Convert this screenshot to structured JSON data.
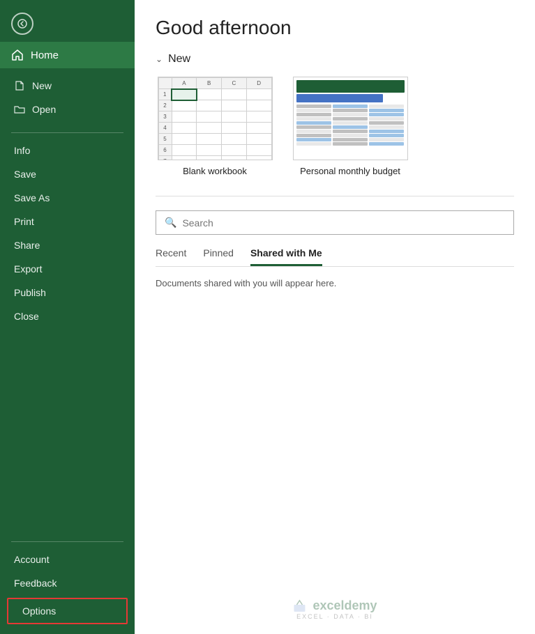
{
  "sidebar": {
    "back_label": "Back",
    "home_label": "Home",
    "nav_items": [
      {
        "id": "new",
        "label": "New",
        "icon": "file-new-icon"
      },
      {
        "id": "open",
        "label": "Open",
        "icon": "folder-icon"
      }
    ],
    "menu_items": [
      {
        "id": "info",
        "label": "Info"
      },
      {
        "id": "save",
        "label": "Save"
      },
      {
        "id": "save-as",
        "label": "Save As"
      },
      {
        "id": "print",
        "label": "Print"
      },
      {
        "id": "share",
        "label": "Share"
      },
      {
        "id": "export",
        "label": "Export"
      },
      {
        "id": "publish",
        "label": "Publish"
      },
      {
        "id": "close",
        "label": "Close"
      }
    ],
    "bottom_items": [
      {
        "id": "account",
        "label": "Account"
      },
      {
        "id": "feedback",
        "label": "Feedback"
      },
      {
        "id": "options",
        "label": "Options"
      }
    ]
  },
  "main": {
    "greeting": "Good afternoon",
    "new_section_label": "New",
    "templates": [
      {
        "id": "blank",
        "label": "Blank workbook"
      },
      {
        "id": "budget",
        "label": "Personal monthly budget"
      }
    ],
    "search_placeholder": "Search",
    "tabs": [
      {
        "id": "recent",
        "label": "Recent"
      },
      {
        "id": "pinned",
        "label": "Pinned"
      },
      {
        "id": "shared",
        "label": "Shared with Me",
        "active": true
      }
    ],
    "empty_message": "Documents shared with you will appear here.",
    "watermark_logo": "exceldemy",
    "watermark_sub": "EXCEL · DATA · BI"
  }
}
